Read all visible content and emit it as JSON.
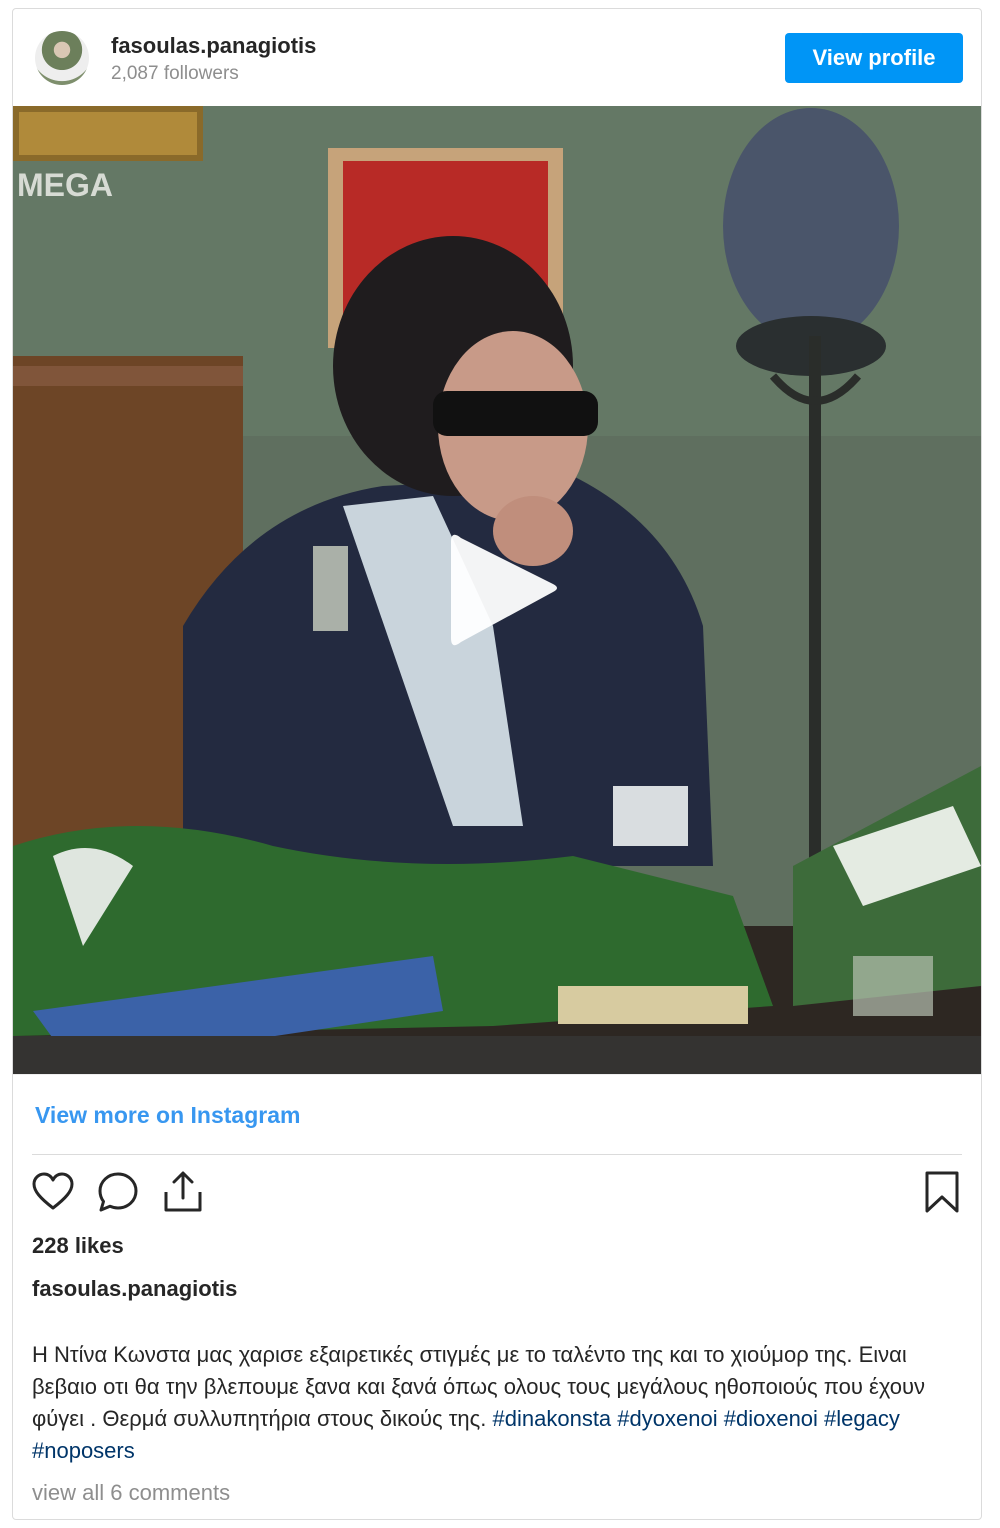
{
  "header": {
    "username": "fasoulas.panagiotis",
    "followers": "2,087 followers",
    "view_profile_label": "View profile"
  },
  "media": {
    "type": "video",
    "watermark": "MEGA",
    "play_icon": "play-icon"
  },
  "view_more_label": "View more on Instagram",
  "actions": {
    "like_icon": "heart-icon",
    "comment_icon": "comment-icon",
    "share_icon": "share-icon",
    "save_icon": "bookmark-icon"
  },
  "likes": "228 likes",
  "caption": {
    "username": "fasoulas.panagiotis",
    "text": "Η Ντίνα Κωνστα μας χαρισε εξαιρετικές στιγμές με το ταλέντο της και το χιούμορ της. Ειναι βεβαιο οτι θα την βλεπουμε ξανα και ξανά όπως ολους τους μεγάλους ηθοποιούς που έχουν φύγει . Θερμά συλλυπητήρια στους δικούς της.",
    "hashtags": [
      "#dinakonsta",
      "#dyoxenoi",
      "#dioxenoi",
      "#legacy",
      "#noposers"
    ]
  },
  "comments_link": "view all 6 comments",
  "colors": {
    "accent": "#0095f6",
    "link": "#3897f0",
    "hashtag": "#003569",
    "muted": "#8e8e8e"
  }
}
